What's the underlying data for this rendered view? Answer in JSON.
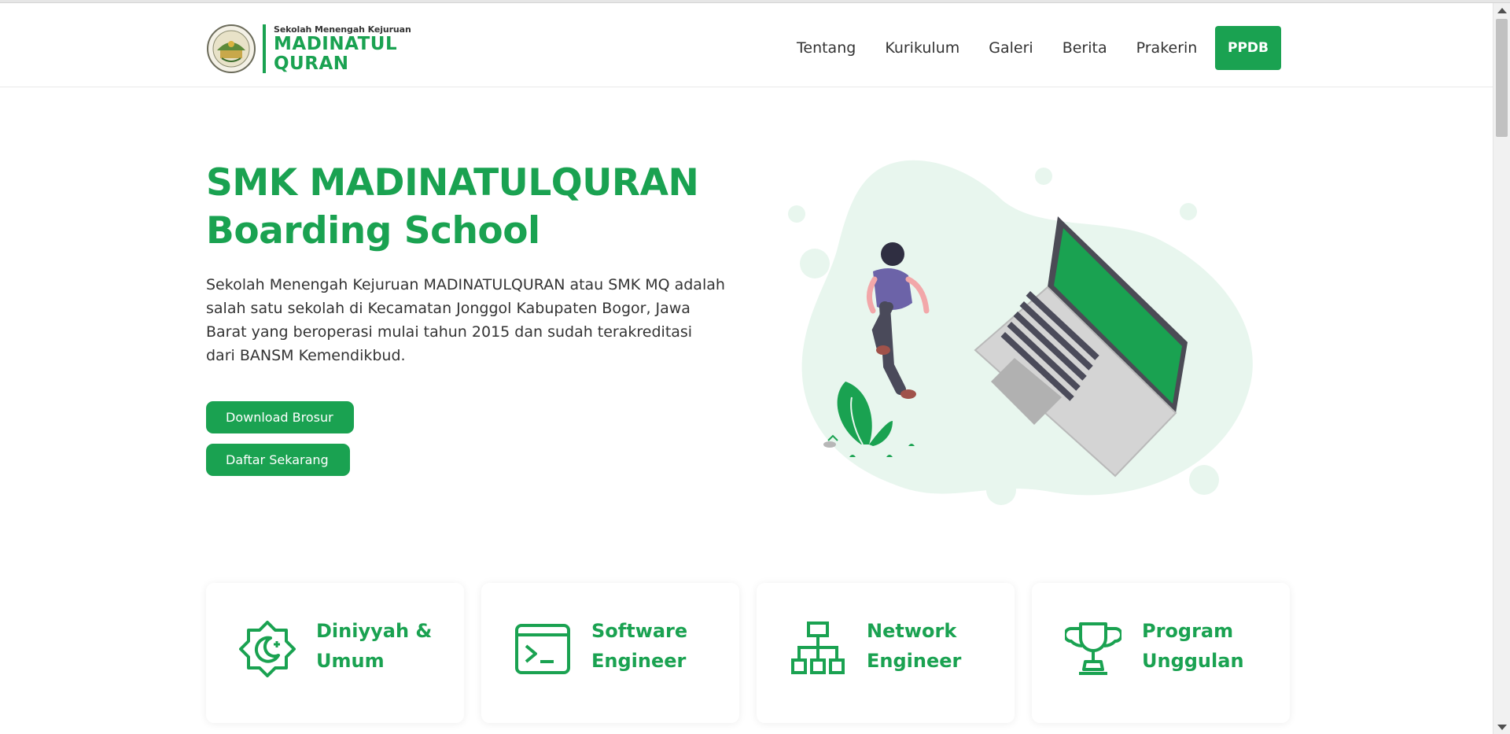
{
  "brand": {
    "tagline": "Sekolah Menengah Kejuruan",
    "name_line1": "MADINATUL",
    "name_line2": "QURAN",
    "color": "#1aa251",
    "emblem_icon": "school-emblem-icon"
  },
  "nav": {
    "items": [
      "Tentang",
      "Kurikulum",
      "Galeri",
      "Berita",
      "Prakerin"
    ],
    "cta": "PPDB"
  },
  "hero": {
    "title_line1": "SMK MADINATULQURAN",
    "title_line2": "Boarding School",
    "description": "Sekolah Menengah Kejuruan MADINATULQURAN atau SMK MQ adalah salah satu sekolah di Kecamatan Jonggol Kabupaten Bogor, Jawa Barat yang beroperasi mulai tahun 2015 dan sudah terakreditasi dari BANSM Kemendikbud.",
    "button_brochure": "Download Brosur",
    "button_register": "Daftar Sekarang",
    "illustration": "person-walking-with-laptop-illustration"
  },
  "programs": [
    {
      "line1": "Diniyyah &",
      "line2": "Umum",
      "icon": "crescent-star-icon"
    },
    {
      "line1": "Software",
      "line2": "Engineer",
      "icon": "terminal-icon"
    },
    {
      "line1": "Network",
      "line2": "Engineer",
      "icon": "network-icon"
    },
    {
      "line1": "Program",
      "line2": "Unggulan",
      "icon": "trophy-icon"
    }
  ]
}
